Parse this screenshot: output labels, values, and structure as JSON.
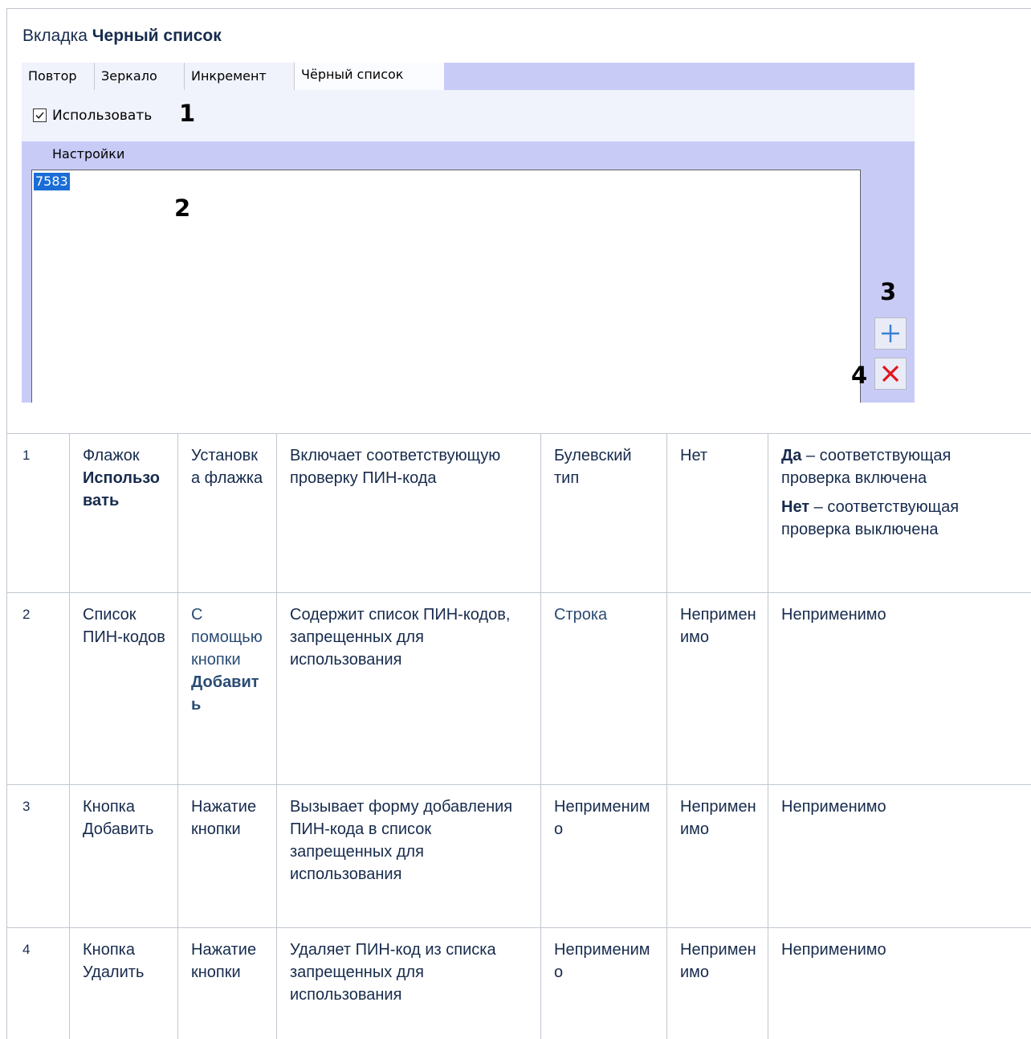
{
  "heading": {
    "prefix": "Вкладка",
    "bold": "Черный список"
  },
  "dialog": {
    "tabs": [
      {
        "label": "Повтор",
        "active": false
      },
      {
        "label": "Зеркало",
        "active": false
      },
      {
        "label": "Инкремент",
        "active": false
      },
      {
        "label": "Чёрный список",
        "active": true
      }
    ],
    "use_checkbox": {
      "label": "Использовать",
      "checked": true
    },
    "settings_label": "Настройки",
    "list_items": [
      "7583"
    ],
    "callouts": {
      "c1": "1",
      "c2": "2",
      "c3": "3",
      "c4": "4"
    },
    "add_icon": "plus-icon",
    "delete_icon": "close-icon"
  },
  "table": {
    "rows": [
      {
        "num": "1",
        "name_prefix": "Флажок",
        "name_bold": "Использовать",
        "method": "Установка флажка",
        "description": "Включает соответствующую проверку ПИН-кода",
        "type": "Булевский тип",
        "default": "Нет",
        "values": [
          {
            "bold": "Да",
            "text": " – соответствующая проверка включена"
          },
          {
            "bold": "Нет",
            "text": " – соответствующая проверка выключена"
          }
        ]
      },
      {
        "num": "2",
        "name": "Список ПИН-кодов",
        "method_link": "С помощью кнопки",
        "method_link_bold": "Добавить",
        "description": "Содержит список ПИН-кодов, запрещенных для использования",
        "type_link": "Строка",
        "default": "Неприменимо",
        "values_text": "Неприменимо"
      },
      {
        "num": "3",
        "name": "Кнопка Добавить",
        "method": "Нажатие кнопки",
        "description": "Вызывает форму добавления ПИН-кода в список запрещенных для использования",
        "type": "Неприменимо",
        "default": "Неприменимо",
        "values_text": "Неприменимо"
      },
      {
        "num": "4",
        "name": "Кнопка Удалить",
        "method": "Нажатие кнопки",
        "description": "Удаляет ПИН-код из списка запрещенных для использования",
        "type": "Неприменимо",
        "default": "Неприменимо",
        "values_text": "Неприменимо"
      }
    ]
  }
}
